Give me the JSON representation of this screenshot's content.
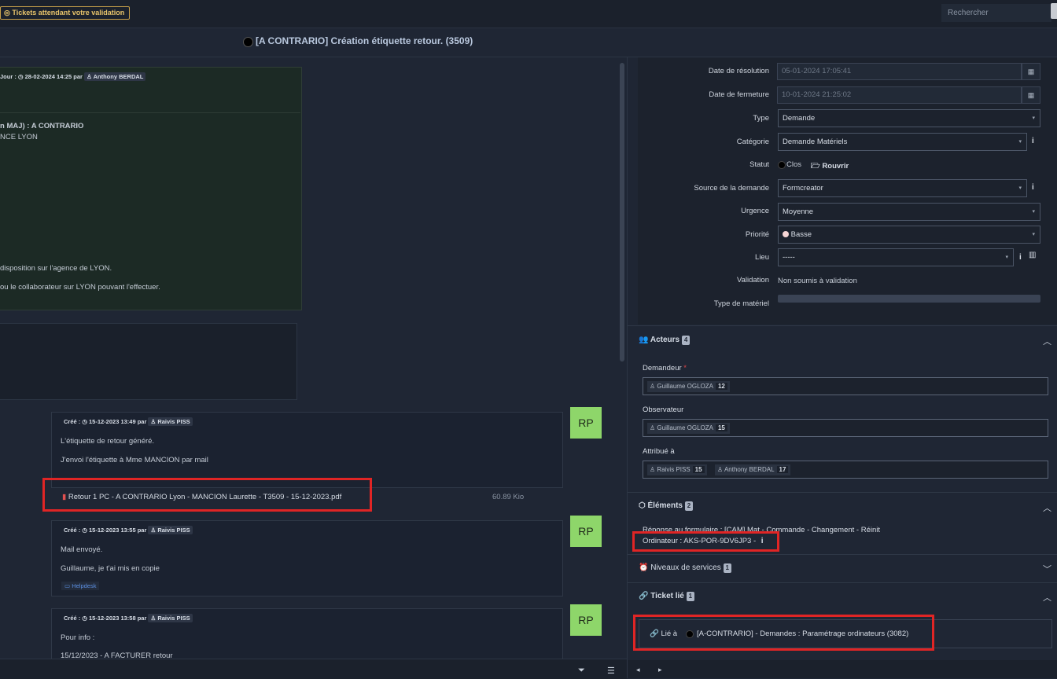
{
  "header": {
    "pending_button": "Tickets attendant votre validation",
    "search_placeholder": "Rechercher",
    "ticket_title": "[A CONTRARIO] Création étiquette retour. (3509)"
  },
  "timeline": {
    "main": {
      "meta_prefix": "Jour :",
      "date": "28-02-2024 14:25 par",
      "author": "Anthony BERDAL",
      "line1": "n MAJ) : A CONTRARIO",
      "line2": "NCE LYON",
      "line3": "disposition sur l'agence de LYON.",
      "line4": "ou le collaborateur sur LYON pouvant l'effectuer."
    },
    "followups": [
      {
        "meta_prefix": "Créé :",
        "date": "15-12-2023 13:49 par",
        "author": "Raivis PISS",
        "lines": [
          "L'étiquette de retour généré.",
          "J'envoi l'étiquette à Mme MANCION par mail"
        ],
        "avatar": "RP",
        "attachment": "Retour 1 PC - A CONTRARIO Lyon - MANCION Laurette - T3509 - 15-12-2023.pdf",
        "attachment_size": "60.89 Kio"
      },
      {
        "meta_prefix": "Créé :",
        "date": "15-12-2023 13:55 par",
        "author": "Raivis PISS",
        "lines": [
          "Mail envoyé.",
          "Guillaume, je t'ai mis en copie"
        ],
        "source": "Helpdesk",
        "avatar": "RP"
      },
      {
        "meta_prefix": "Créé :",
        "date": "15-12-2023 13:58 par",
        "author": "Raivis PISS",
        "lines": [
          "Pour info :",
          "15/12/2023 - A FACTURER retour"
        ],
        "avatar": "RP"
      }
    ]
  },
  "fields": {
    "date_resolution": {
      "label": "Date de résolution",
      "value": "05-01-2024 17:05:41"
    },
    "date_fermeture": {
      "label": "Date de fermeture",
      "value": "10-01-2024 21:25:02"
    },
    "type": {
      "label": "Type",
      "value": "Demande"
    },
    "categorie": {
      "label": "Catégorie",
      "value": "Demande Matériels"
    },
    "statut": {
      "label": "Statut",
      "value": "Clos",
      "reopen": "Rouvrir"
    },
    "source": {
      "label": "Source de la demande",
      "value": "Formcreator"
    },
    "urgence": {
      "label": "Urgence",
      "value": "Moyenne"
    },
    "priorite": {
      "label": "Priorité",
      "value": "Basse"
    },
    "lieu": {
      "label": "Lieu",
      "value": "-----"
    },
    "validation": {
      "label": "Validation",
      "value": "Non soumis à validation"
    },
    "type_materiel": {
      "label": "Type de matériel",
      "value": ""
    }
  },
  "acteurs": {
    "title": "Acteurs",
    "count": "4",
    "demandeur_label": "Demandeur",
    "required_mark": "*",
    "demandeur": [
      {
        "name": "Guillaume OGLOZA",
        "count": "12"
      }
    ],
    "observateur_label": "Observateur",
    "observateur": [
      {
        "name": "Guillaume OGLOZA",
        "count": "15"
      }
    ],
    "attribue_label": "Attribué à",
    "attribue": [
      {
        "name": "Raivis PISS",
        "count": "15"
      },
      {
        "name": "Anthony BERDAL",
        "count": "17"
      }
    ]
  },
  "elements": {
    "title": "Éléments",
    "count": "2",
    "line1": "Réponse au formulaire : [CAM] Mat - Commande - Changement - Réinit",
    "line2": "Ordinateur : AKS-POR-9DV6JP3 -"
  },
  "niveaux": {
    "title": "Niveaux de services",
    "count": "1"
  },
  "ticket_lie": {
    "title": "Ticket lié",
    "count": "1",
    "relation": "Lié à",
    "link": "[A-CONTRARIO] - Demandes : Paramétrage ordinateurs (3082)"
  },
  "colors": {
    "accent_green": "#8ed66a",
    "highlight_red": "#e02525",
    "priority_basse": "#f6d5d5"
  }
}
